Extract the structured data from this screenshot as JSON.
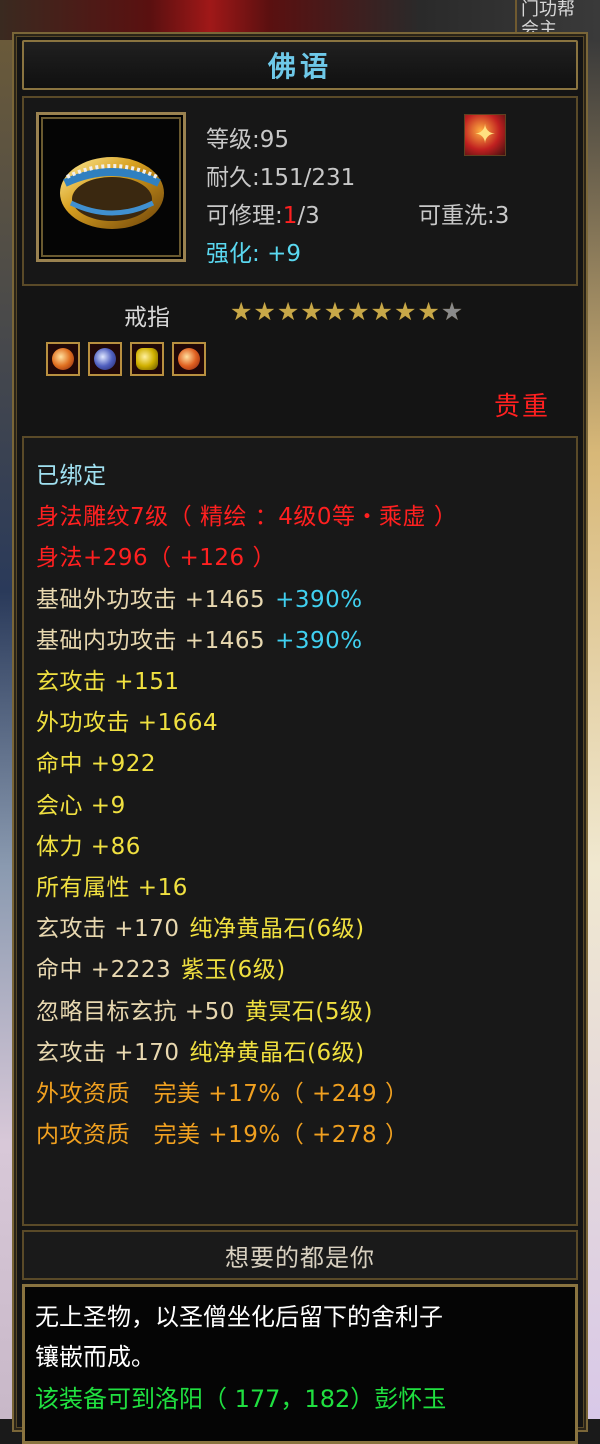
{
  "background": {
    "right_corner_text": "门功帮\n会主"
  },
  "item": {
    "name": "佛语",
    "level_label": "等级",
    "level_value": "95",
    "durability_label": "耐久",
    "durability_value": "151/231",
    "repair_label": "可修理",
    "repair_used": "1",
    "repair_total": "/3",
    "rewash_label": "可重洗",
    "rewash_value": "3",
    "enhance_label": "强化",
    "enhance_value": "+9",
    "type_icon": "fire-swirl-icon",
    "category": "戒指",
    "stars_filled": 9,
    "stars_total": 10,
    "gems": [
      "orange-gem-icon",
      "blue-gem-icon",
      "yellow-gem-icon",
      "orange-gem-icon"
    ],
    "rarity": "贵重"
  },
  "attributes": [
    {
      "text": "已绑定",
      "color": "cyan"
    },
    {
      "text": "身法雕纹7级（ 精绘 ：4级0等・乘虚 ）",
      "color": "red"
    },
    {
      "text": "身法+296（ +126 ）",
      "color": "red"
    },
    {
      "text": "基础外功攻击 +1465",
      "extra": "+390%",
      "color": "beige"
    },
    {
      "text": "基础内功攻击 +1465",
      "extra": "+390%",
      "color": "beige"
    },
    {
      "text": "玄攻击 +151",
      "color": "yellow"
    },
    {
      "text": "外功攻击 +1664",
      "color": "yellow"
    },
    {
      "text": "命中 +922",
      "color": "yellow"
    },
    {
      "text": "会心 +9",
      "color": "yellow"
    },
    {
      "text": "体力 +86",
      "color": "yellow"
    },
    {
      "text": "所有属性 +16",
      "color": "yellow"
    },
    {
      "text": "玄攻击 +170",
      "extra": "纯净黄晶石(6级)",
      "color": "beige"
    },
    {
      "text": "命中 +2223",
      "extra": "紫玉(6级)",
      "color": "beige"
    },
    {
      "text": "忽略目标玄抗 +50",
      "extra": "黄冥石(5级)",
      "color": "beige"
    },
    {
      "text": "玄攻击 +170",
      "extra": "纯净黄晶石(6级)",
      "color": "beige"
    },
    {
      "text": "外攻资质　完美 +17%（ +249 ）",
      "color": "orange"
    },
    {
      "text": "内攻资质　完美 +19%（ +278 ）",
      "color": "orange"
    }
  ],
  "footer": {
    "title": "想要的都是你",
    "desc_line1": "无上圣物，以圣僧坐化后留下的舍利子",
    "desc_line2": "镶嵌而成。",
    "desc_line3": "该装备可到洛阳（ 177，182）彭怀玉"
  }
}
